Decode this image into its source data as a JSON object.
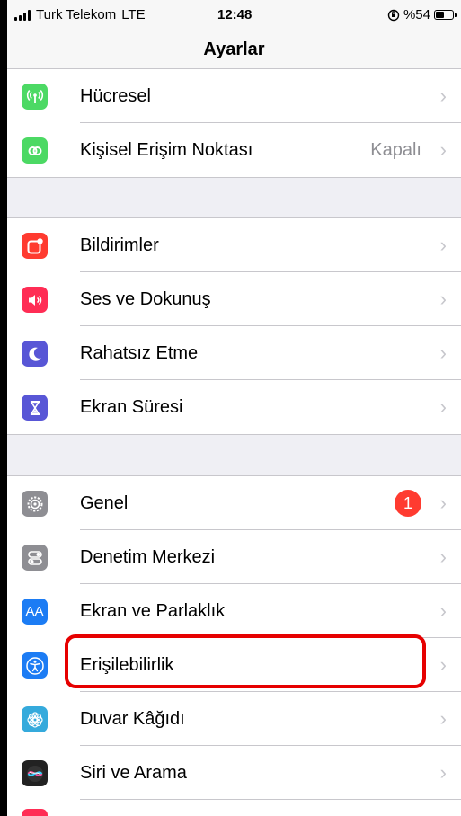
{
  "status_bar": {
    "carrier": "Turk Telekom",
    "network": "LTE",
    "time": "12:48",
    "battery_text": "%54",
    "battery_level": 0.54
  },
  "nav": {
    "title": "Ayarlar"
  },
  "groups": [
    {
      "rows": [
        {
          "label": "Hücresel",
          "icon": "antenna-icon",
          "color": "#4cd964"
        },
        {
          "label": "Kişisel Erişim Noktası",
          "value": "Kapalı",
          "icon": "link-icon",
          "color": "#4cd964"
        }
      ]
    },
    {
      "rows": [
        {
          "label": "Bildirimler",
          "icon": "notifications-icon",
          "color": "#ff3b30"
        },
        {
          "label": "Ses ve Dokunuş",
          "icon": "speaker-icon",
          "color": "#ff2d55"
        },
        {
          "label": "Rahatsız Etme",
          "icon": "moon-icon",
          "color": "#5856d6"
        },
        {
          "label": "Ekran Süresi",
          "icon": "hourglass-icon",
          "color": "#5856d6"
        }
      ]
    },
    {
      "rows": [
        {
          "label": "Genel",
          "badge": "1",
          "icon": "gear-icon",
          "color": "#8e8e93"
        },
        {
          "label": "Denetim Merkezi",
          "icon": "toggles-icon",
          "color": "#8e8e93"
        },
        {
          "label": "Ekran ve Parlaklık",
          "icon": "text-size-icon",
          "icon_text": "AA",
          "color": "#1c7cf4"
        },
        {
          "label": "Erişilebilirlik",
          "icon": "accessibility-icon",
          "color": "#1c7cf4"
        },
        {
          "label": "Duvar Kâğıdı",
          "icon": "flower-icon",
          "color": "#35aadc"
        },
        {
          "label": "Siri ve Arama",
          "icon": "siri-icon",
          "color": "#222222"
        }
      ]
    }
  ],
  "colors": {
    "highlight": "#e60000",
    "badge": "#ff3b30",
    "chevron": "#c7c7cc"
  }
}
